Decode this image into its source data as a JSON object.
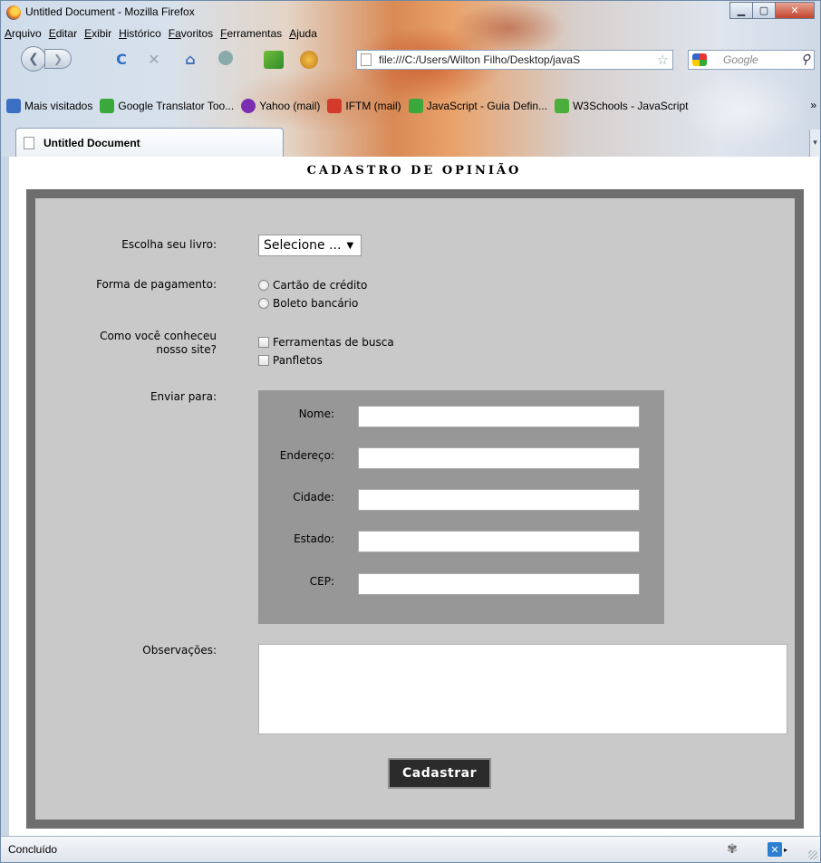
{
  "window": {
    "title": "Untitled Document - Mozilla Firefox",
    "minimize_glyph": "▁",
    "maximize_glyph": "▢",
    "close_glyph": "✕"
  },
  "menubar": {
    "items": [
      {
        "first": "A",
        "rest": "rquivo"
      },
      {
        "first": "E",
        "rest": "ditar"
      },
      {
        "first": "E",
        "rest": "xibir"
      },
      {
        "first": "H",
        "rest": "istórico"
      },
      {
        "first": "Fa",
        "rest": "voritos"
      },
      {
        "first": "F",
        "rest": "erramentas"
      },
      {
        "first": "Aj",
        "rest": "uda"
      }
    ]
  },
  "navbar": {
    "url": "file:///C:/Users/Wilton Filho/Desktop/javaS",
    "search_placeholder": "Google",
    "back_glyph": "❮",
    "forward_glyph": "❯",
    "reload_glyph": "C",
    "stop_glyph": "✕",
    "home_glyph": "⌂",
    "star_glyph": "☆",
    "search_glyph": "⚲"
  },
  "bookmarks": {
    "items": [
      {
        "label": "Mais visitados",
        "color": "#3b6fc4"
      },
      {
        "label": "Google Translator Too...",
        "color": "#3aa83a"
      },
      {
        "label": "Yahoo (mail)",
        "color": "#7b2fb0"
      },
      {
        "label": "IFTM (mail)",
        "color": "#d33a2c"
      },
      {
        "label": "JavaScript - Guia Defin...",
        "color": "#3aa83a"
      },
      {
        "label": "W3Schools - JavaScript",
        "color": "#4cae3a"
      }
    ],
    "more_glyph": "»"
  },
  "tab": {
    "title": "Untitled Document",
    "scroll_glyph": "▾"
  },
  "page": {
    "heading": "CADASTRO DE OPINIÃO",
    "book_label": "Escolha seu livro:",
    "book_select_value": "Selecione ...",
    "book_select_arrow": "▼",
    "payment_label": "Forma de pagamento:",
    "payment_options": [
      "Cartão de crédito",
      "Boleto bancário"
    ],
    "discovery_label_line1": "Como você conheceu",
    "discovery_label_line2": "nosso site?",
    "discovery_options": [
      "Ferramentas de busca",
      "Panfletos"
    ],
    "send_to_label": "Enviar para:",
    "address_fields": {
      "name": "Nome:",
      "address": "Endereço:",
      "city": "Cidade:",
      "state": "Estado:",
      "zip": "CEP:"
    },
    "notes_label": "Observações:",
    "submit_label": "Cadastrar"
  },
  "status": {
    "text": "Concluído"
  }
}
